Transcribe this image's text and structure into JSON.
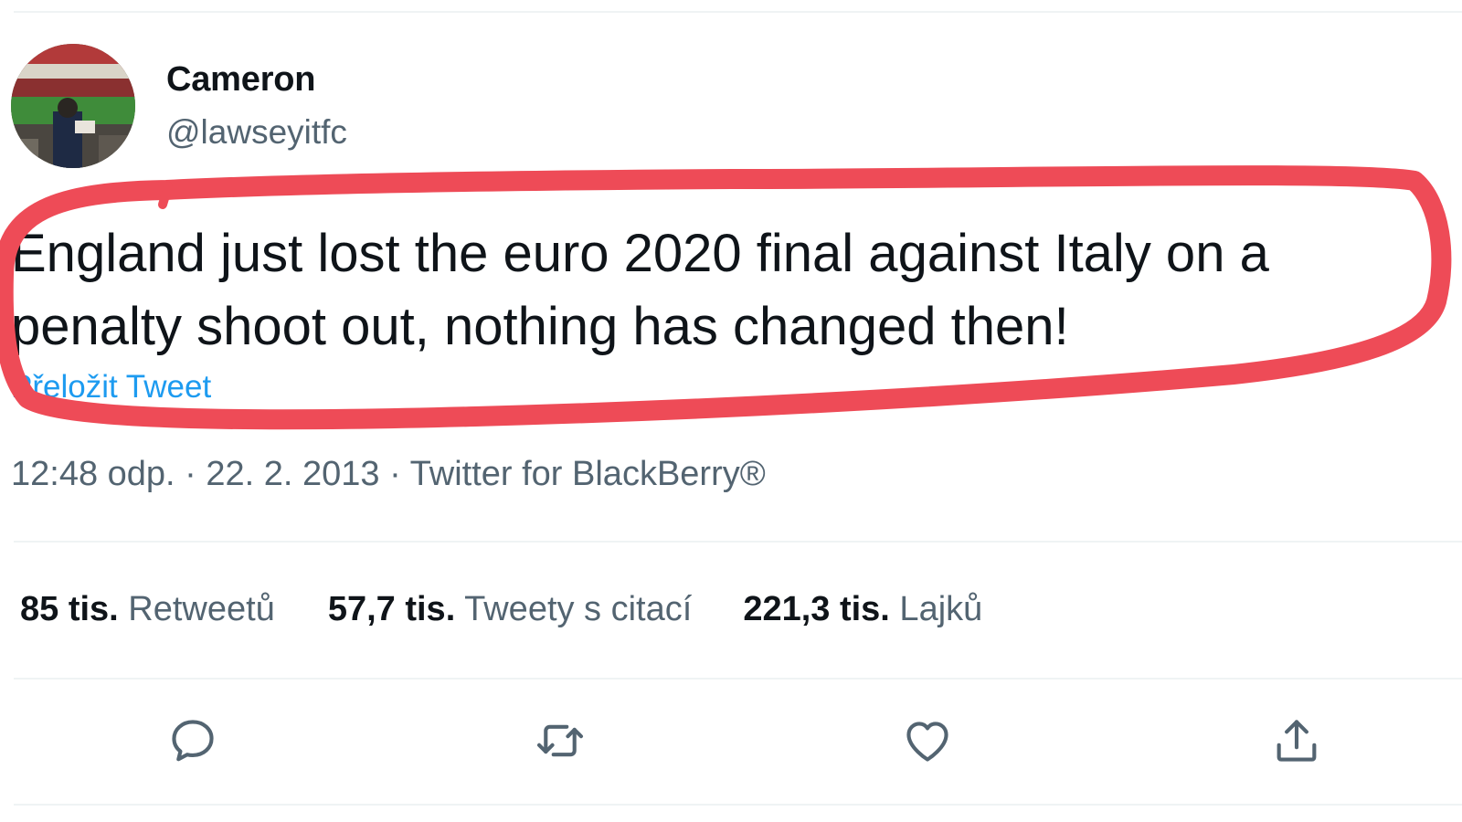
{
  "author": {
    "name": "Cameron",
    "handle": "@lawseyitfc"
  },
  "tweet": {
    "text_line_1": "England just lost the euro 2020 final against Italy on a",
    "text_line_2": "penalty shoot out, nothing has changed then!",
    "translate_label": "Přeložit Tweet"
  },
  "meta": {
    "time": "12:48 odp.",
    "separator_1": " · ",
    "date": "22. 2. 2013",
    "separator_2": " · ",
    "source": "Twitter for BlackBerry®"
  },
  "stats": {
    "retweets_count": "85 tis.",
    "retweets_label": " Retweetů",
    "quotes_count": "57,7 tis.",
    "quotes_label": " Tweety s citací",
    "likes_count": "221,3 tis.",
    "likes_label": " Lajků"
  },
  "actions": {
    "reply_icon": "speech-bubble-icon",
    "retweet_icon": "retweet-arrows-icon",
    "like_icon": "heart-icon",
    "share_icon": "share-upload-icon"
  },
  "colors": {
    "highlight": "#ee4b57",
    "link": "#1d9bf0",
    "secondary_text": "#536471",
    "primary_text": "#0f1419",
    "divider": "#eff3f4"
  }
}
